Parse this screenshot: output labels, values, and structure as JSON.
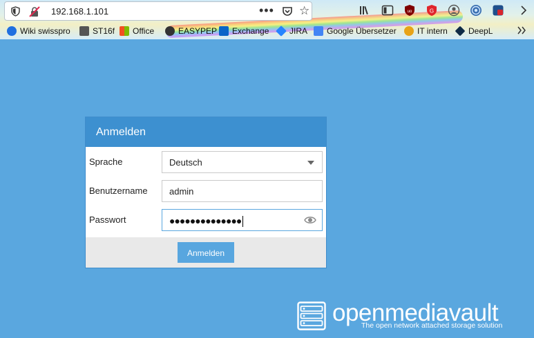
{
  "browser": {
    "url": "192.168.1.101",
    "bookmarks": [
      {
        "label": "Wiki swisspro",
        "color": "#1f6fe0"
      },
      {
        "label": "ST16f",
        "color": "#555555"
      },
      {
        "label": "Office",
        "color": "#f25022"
      },
      {
        "label": "EASYPEP",
        "color": "#333333"
      },
      {
        "label": "Exchange",
        "color": "#0a64c8"
      },
      {
        "label": "JIRA",
        "color": "#2684ff"
      },
      {
        "label": "Google Übersetzer",
        "color": "#4285f4"
      },
      {
        "label": "IT intern",
        "color": "#e8a317"
      },
      {
        "label": "DeepL",
        "color": "#0f2b46"
      }
    ],
    "icons": [
      "shield-icon",
      "insecure-lock-icon",
      "more-dots-icon",
      "pocket-icon",
      "bookmark-star-icon",
      "library-icon",
      "sidebar-icon",
      "ublock-icon",
      "extension-icon",
      "account-icon",
      "globe-extension-icon",
      "extension-badge-icon"
    ]
  },
  "login": {
    "title": "Anmelden",
    "language_label": "Sprache",
    "language_value": "Deutsch",
    "username_label": "Benutzername",
    "username_value": "admin",
    "password_label": "Passwort",
    "password_mask": "●●●●●●●●●●●●●●",
    "submit_label": "Anmelden"
  },
  "branding": {
    "name": "openmediavault",
    "tagline": "The open network attached storage solution"
  }
}
